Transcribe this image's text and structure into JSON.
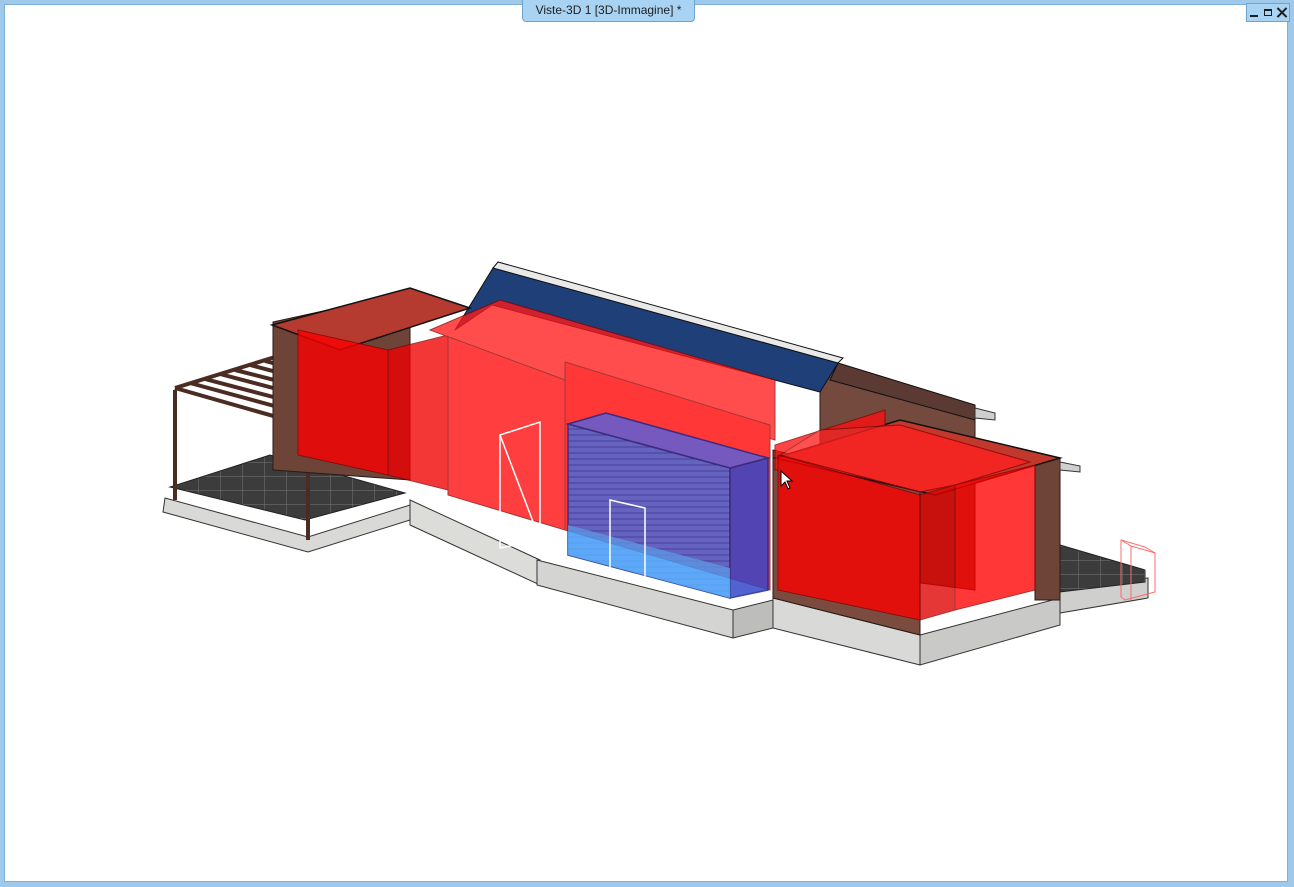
{
  "window": {
    "title": "Viste-3D 1 [3D-Immagine] *",
    "controls": {
      "minimize_icon": "minimize-icon",
      "restore_icon": "restore-icon",
      "close_icon": "close-icon"
    }
  },
  "scene": {
    "description_icon": "3d-building-model",
    "colors": {
      "highlight_red": "#ff0000",
      "highlight_blue": "#3a4ad8",
      "roof_membrane": "#1f3f78",
      "wall_brown": "#6e4438",
      "paving": "#3a3a3a",
      "base": "#d6d6d4"
    }
  },
  "cursor": {
    "icon": "mouse-pointer-icon"
  }
}
